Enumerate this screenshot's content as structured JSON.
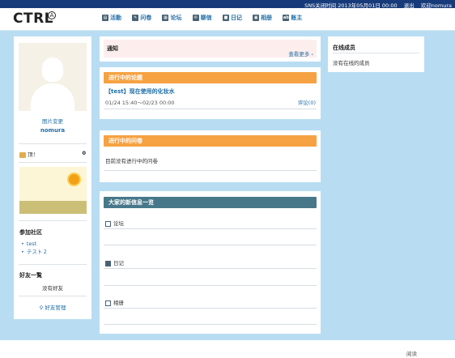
{
  "topbar": {
    "sns_close_time": "SNS关闭时间 2013年05月01日 00:00",
    "logout": "退出",
    "welcome": "欢迎nomura"
  },
  "header": {
    "logo": "CTRL",
    "logo_mark": "A"
  },
  "nav": {
    "items": [
      {
        "label": "活動",
        "icon": "activity-icon"
      },
      {
        "label": "问卷",
        "icon": "questionnaire-icon"
      },
      {
        "label": "论坛",
        "icon": "forum-icon"
      },
      {
        "label": "聊信",
        "icon": "message-icon"
      },
      {
        "label": "日记",
        "icon": "diary-icon"
      },
      {
        "label": "相册",
        "icon": "album-icon"
      },
      {
        "label": "账主",
        "icon": "account-icon"
      }
    ]
  },
  "profile": {
    "photo_change": "图片变更",
    "username": "nomura",
    "like_label": "顶！",
    "like_count": "0"
  },
  "community": {
    "title": "参加社区",
    "items": [
      "test",
      "テスト２"
    ]
  },
  "friends": {
    "title": "好友一覧",
    "empty": "没有好友",
    "manage": "好友管理"
  },
  "notice": {
    "title": "通知",
    "more": "查看更多 ›"
  },
  "topics": {
    "header": "进行中的论题",
    "link": "【test】现在使用的化妆水",
    "date": "01/24 15:40〜02/23 00:00",
    "comment": "评论(0)"
  },
  "questionnaire": {
    "header": "进行中的问卷",
    "empty": "目前没有进行中的问卷"
  },
  "news": {
    "header": "大家的新信息一览",
    "categories": [
      "论坛",
      "日记",
      "相册"
    ]
  },
  "online": {
    "title": "在线成员",
    "empty": "没有在线的成员"
  },
  "footer": {
    "link": "阅读"
  },
  "colors": {
    "topbar": "#173b7a",
    "background": "#b8ddf3",
    "orange_header": "#f6a242",
    "teal_header": "#47788a",
    "link": "#1f6ea7"
  }
}
